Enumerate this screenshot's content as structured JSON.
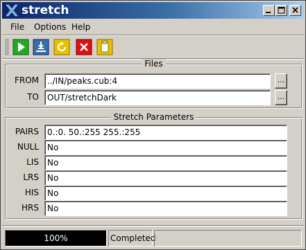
{
  "window": {
    "title": "stretch",
    "title_bar_colors": [
      "#0a246a",
      "#a6caf0"
    ]
  },
  "menu": {
    "items": [
      {
        "label": "File"
      },
      {
        "label": "Options"
      },
      {
        "label": "Help"
      }
    ]
  },
  "toolbar": {
    "buttons": [
      {
        "icon": "run-icon",
        "color": "#22aa22"
      },
      {
        "icon": "run-reset-icon",
        "color": "#3a6ea5"
      },
      {
        "icon": "reset-icon",
        "color": "#e8c000"
      },
      {
        "icon": "exit-icon",
        "color": "#e01010"
      },
      {
        "icon": "clipboard-icon",
        "color": "#e8c000"
      }
    ]
  },
  "files": {
    "title": "Files",
    "from_label": "FROM",
    "from_value": "../IN/peaks.cub:4",
    "to_label": "TO",
    "to_value": "OUT/stretchDark",
    "browse_label": "..."
  },
  "stretch": {
    "title": "Stretch Parameters",
    "fields": [
      {
        "label": "PAIRS",
        "value": "0.:0. 50.:255 255.:255"
      },
      {
        "label": "NULL",
        "value": "No"
      },
      {
        "label": "LIS",
        "value": "No"
      },
      {
        "label": "LRS",
        "value": "No"
      },
      {
        "label": "HIS",
        "value": "No"
      },
      {
        "label": "HRS",
        "value": "No"
      }
    ]
  },
  "status": {
    "progress_text": "100%",
    "progress_fraction": 1.0,
    "state": "Completed"
  }
}
